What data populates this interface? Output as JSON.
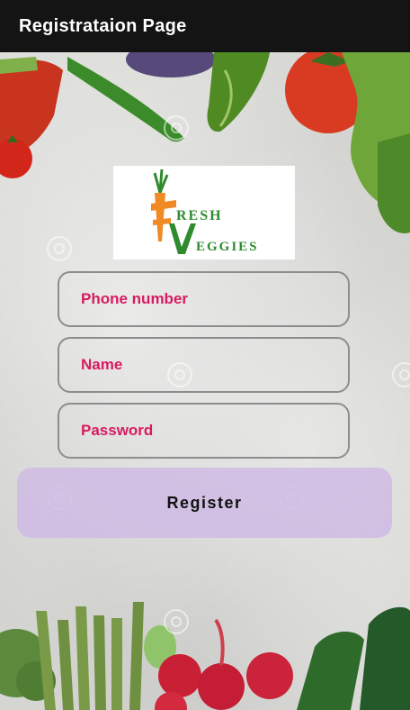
{
  "appbar": {
    "title": "Registrataion Page"
  },
  "logo": {
    "line1": "RESH",
    "line2": "EGGIES",
    "letter_f": "F",
    "letter_v": "V"
  },
  "form": {
    "phone_placeholder": "Phone number",
    "name_placeholder": "Name",
    "password_placeholder": "Password"
  },
  "actions": {
    "register_label": "Register"
  },
  "colors": {
    "appbar": "#141414",
    "hint": "#d81b60",
    "button": "#cebae4",
    "logo_orange": "#f08a24",
    "logo_green": "#2e8b2e"
  }
}
